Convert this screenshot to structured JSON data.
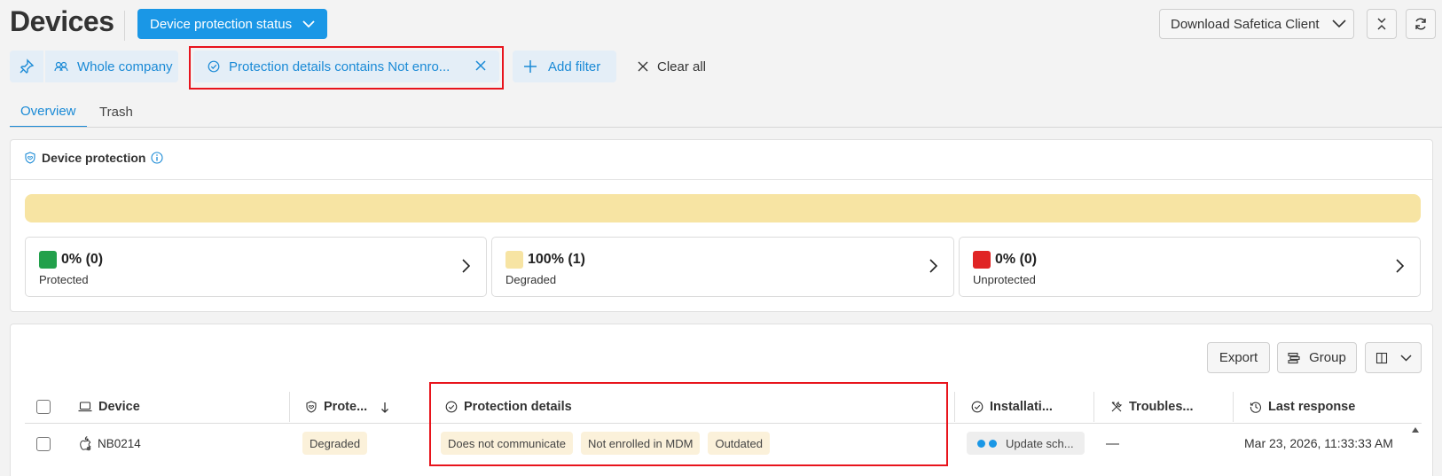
{
  "header": {
    "title": "Devices",
    "status_button": "Device protection status",
    "download_button": "Download Safetica Client"
  },
  "filters": {
    "company": "Whole company",
    "protection": "Protection details contains Not enro...",
    "add": "Add filter",
    "clear": "Clear all"
  },
  "tabs": {
    "overview": "Overview",
    "trash": "Trash"
  },
  "protection_card": {
    "title": "Device protection",
    "stats": [
      {
        "value": "0% (0)",
        "label": "Protected",
        "color": "#22a04b"
      },
      {
        "value": "100% (1)",
        "label": "Degraded",
        "color": "#f7e4a3"
      },
      {
        "value": "0% (0)",
        "label": "Unprotected",
        "color": "#e02424"
      }
    ]
  },
  "table": {
    "actions": {
      "export": "Export",
      "group": "Group"
    },
    "columns": {
      "device": "Device",
      "protection": "Prote...",
      "details": "Protection details",
      "installation": "Installati...",
      "troubleshooting": "Troubles...",
      "last_response": "Last response"
    },
    "rows": [
      {
        "device": "NB0214",
        "protection": "Degraded",
        "details": [
          "Does not communicate",
          "Not enrolled in MDM",
          "Outdated"
        ],
        "installation": "Update sch...",
        "troubleshooting": "—",
        "last_response": "Mar 23, 2026, 11:33:33 AM"
      }
    ]
  }
}
